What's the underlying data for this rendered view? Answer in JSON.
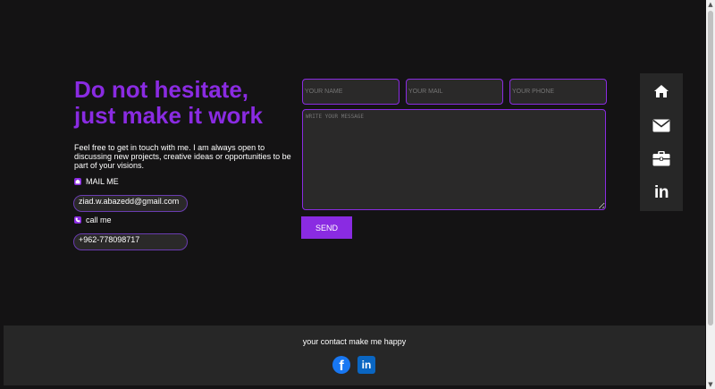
{
  "hero": {
    "heading_line1": "Do not hesitate,",
    "heading_line2": "just make it work",
    "intro": "Feel free to get in touch with me. I am always open to discussing new projects, creative ideas or opportunities to be part of your visions."
  },
  "contact": {
    "mail_label": "MAIL ME",
    "mail_value": "ziad.w.abazedd@gmail.com",
    "call_label": "call me",
    "phone_value": "+962-778098717"
  },
  "form": {
    "name_placeholder": "YOUR NAME",
    "mail_placeholder": "YOUR MAIL",
    "phone_placeholder": "YOUR PHONE",
    "message_placeholder": "WRITE YOUR MESSAGE",
    "send_label": "SEND"
  },
  "side_nav": {
    "items": [
      {
        "icon": "home-icon"
      },
      {
        "icon": "envelope-icon"
      },
      {
        "icon": "briefcase-icon"
      },
      {
        "icon": "linkedin-icon",
        "glyph": "in"
      }
    ]
  },
  "footer": {
    "text": "your contact make me happy",
    "facebook_glyph": "f",
    "linkedin_glyph": "in"
  },
  "colors": {
    "accent": "#8a2be2",
    "background": "#141314",
    "panel": "#272727"
  }
}
